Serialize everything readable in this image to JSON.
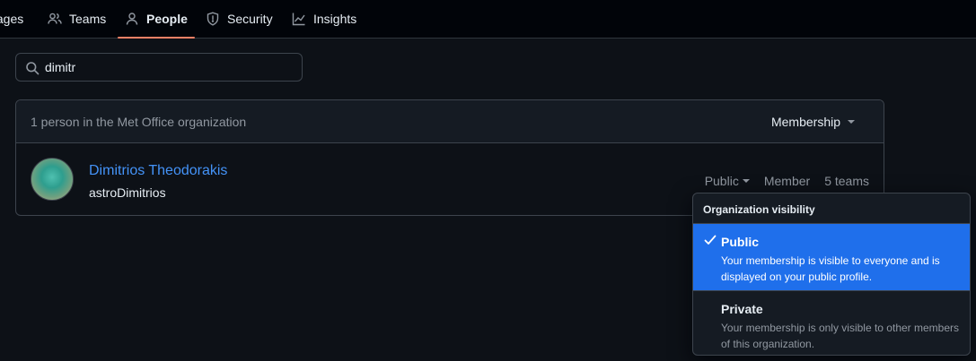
{
  "nav": {
    "items": [
      {
        "label": "tages",
        "icon": "packages-icon"
      },
      {
        "label": "Teams",
        "icon": "people-icon"
      },
      {
        "label": "People",
        "icon": "person-icon",
        "active": true
      },
      {
        "label": "Security",
        "icon": "shield-icon"
      },
      {
        "label": "Insights",
        "icon": "graph-icon"
      }
    ]
  },
  "search": {
    "value": "dimitr",
    "icon": "search-icon"
  },
  "members": {
    "count_text": "1 person in the Met Office organization",
    "membership_label": "Membership",
    "rows": [
      {
        "name": "Dimitrios Theodorakis",
        "login": "astroDimitrios",
        "visibility": "Public",
        "role": "Member",
        "teams": "5 teams"
      }
    ]
  },
  "visibility_menu": {
    "title": "Organization visibility",
    "options": [
      {
        "label": "Public",
        "description": "Your membership is visible to everyone and is displayed on your public profile.",
        "selected": true
      },
      {
        "label": "Private",
        "description": "Your membership is only visible to other members of this organization.",
        "selected": false
      }
    ]
  },
  "colors": {
    "accent": "#4493f8",
    "selected_bg": "#1f6feb",
    "active_underline": "#f78166"
  }
}
